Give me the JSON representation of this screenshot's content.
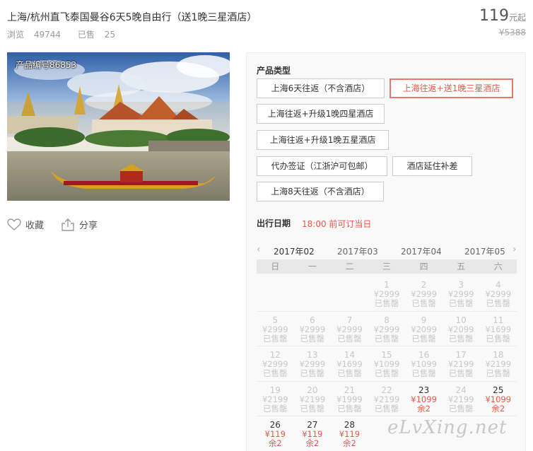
{
  "product": {
    "title": "上海/杭州直飞泰国曼谷6天5晚自由行（送1晚三星酒店）",
    "views_label": "浏览",
    "views": "49744",
    "sold_label": "已售",
    "sold": "25",
    "price": "119",
    "price_unit": "元起",
    "original_price": "¥5388",
    "code_label": "产品编号86853"
  },
  "actions": {
    "favorite": "收藏",
    "share": "分享"
  },
  "product_type": {
    "title": "产品类型",
    "options": [
      "上海6天往返（不含酒店）",
      "上海往返+送1晚三星酒店",
      "上海往返+升级1晚四星酒店",
      "上海往返+升级1晚五星酒店",
      "代办签证（江浙沪可包邮）",
      "酒店延住补差",
      "上海8天往返（不含酒店）"
    ],
    "selected_index": 1
  },
  "departure": {
    "title": "出行日期",
    "note": "18:00 前可订当日",
    "prev_arrow": "‹",
    "next_arrow": "›",
    "months": [
      "2017年02",
      "2017年03",
      "2017年04",
      "2017年05"
    ],
    "active_month": 0,
    "weekdays": [
      "日",
      "一",
      "二",
      "三",
      "四",
      "五",
      "六"
    ],
    "weeks": [
      [
        null,
        null,
        null,
        {
          "d": "1",
          "p": "¥2999",
          "s": "已售罄"
        },
        {
          "d": "2",
          "p": "¥2999",
          "s": "已售罄"
        },
        {
          "d": "3",
          "p": "¥2999",
          "s": "已售罄"
        },
        {
          "d": "4",
          "p": "¥2999",
          "s": "已售罄"
        }
      ],
      [
        {
          "d": "5",
          "p": "¥2999",
          "s": "已售罄"
        },
        {
          "d": "6",
          "p": "¥2999",
          "s": "已售罄"
        },
        {
          "d": "7",
          "p": "¥2999",
          "s": "已售罄"
        },
        {
          "d": "8",
          "p": "¥2999",
          "s": "已售罄"
        },
        {
          "d": "9",
          "p": "¥2099",
          "s": "已售罄"
        },
        {
          "d": "10",
          "p": "¥2099",
          "s": "已售罄"
        },
        {
          "d": "11",
          "p": "¥1699",
          "s": "已售罄"
        }
      ],
      [
        {
          "d": "12",
          "p": "¥2999",
          "s": "已售罄"
        },
        {
          "d": "13",
          "p": "¥2999",
          "s": "已售罄"
        },
        {
          "d": "14",
          "p": "¥1699",
          "s": "已售罄"
        },
        {
          "d": "15",
          "p": "¥1099",
          "s": "已售罄"
        },
        {
          "d": "16",
          "p": "¥1099",
          "s": "已售罄"
        },
        {
          "d": "17",
          "p": "¥2199",
          "s": "已售罄"
        },
        {
          "d": "18",
          "p": "¥2199",
          "s": "已售罄"
        }
      ],
      [
        {
          "d": "19",
          "p": "¥2199",
          "s": "已售罄"
        },
        {
          "d": "20",
          "p": "¥2199",
          "s": "已售罄"
        },
        {
          "d": "21",
          "p": "¥1999",
          "s": "已售罄"
        },
        {
          "d": "22",
          "p": "¥2199",
          "s": "已售罄"
        },
        {
          "d": "23",
          "p": "¥1099",
          "s": "余2",
          "a": true
        },
        {
          "d": "24",
          "p": "¥2199",
          "s": "已售罄"
        },
        {
          "d": "25",
          "p": "¥1099",
          "s": "余2",
          "a": true
        }
      ],
      [
        {
          "d": "26",
          "p": "¥119",
          "s": "余2",
          "a": true
        },
        {
          "d": "27",
          "p": "¥119",
          "s": "余2",
          "a": true
        },
        {
          "d": "28",
          "p": "¥119",
          "s": "余2",
          "a": true
        },
        null,
        null,
        null,
        null
      ]
    ]
  },
  "watermark": "eLvXing.net",
  "colors": {
    "accent": "#e25a4a",
    "selected_border": "#e87968"
  }
}
